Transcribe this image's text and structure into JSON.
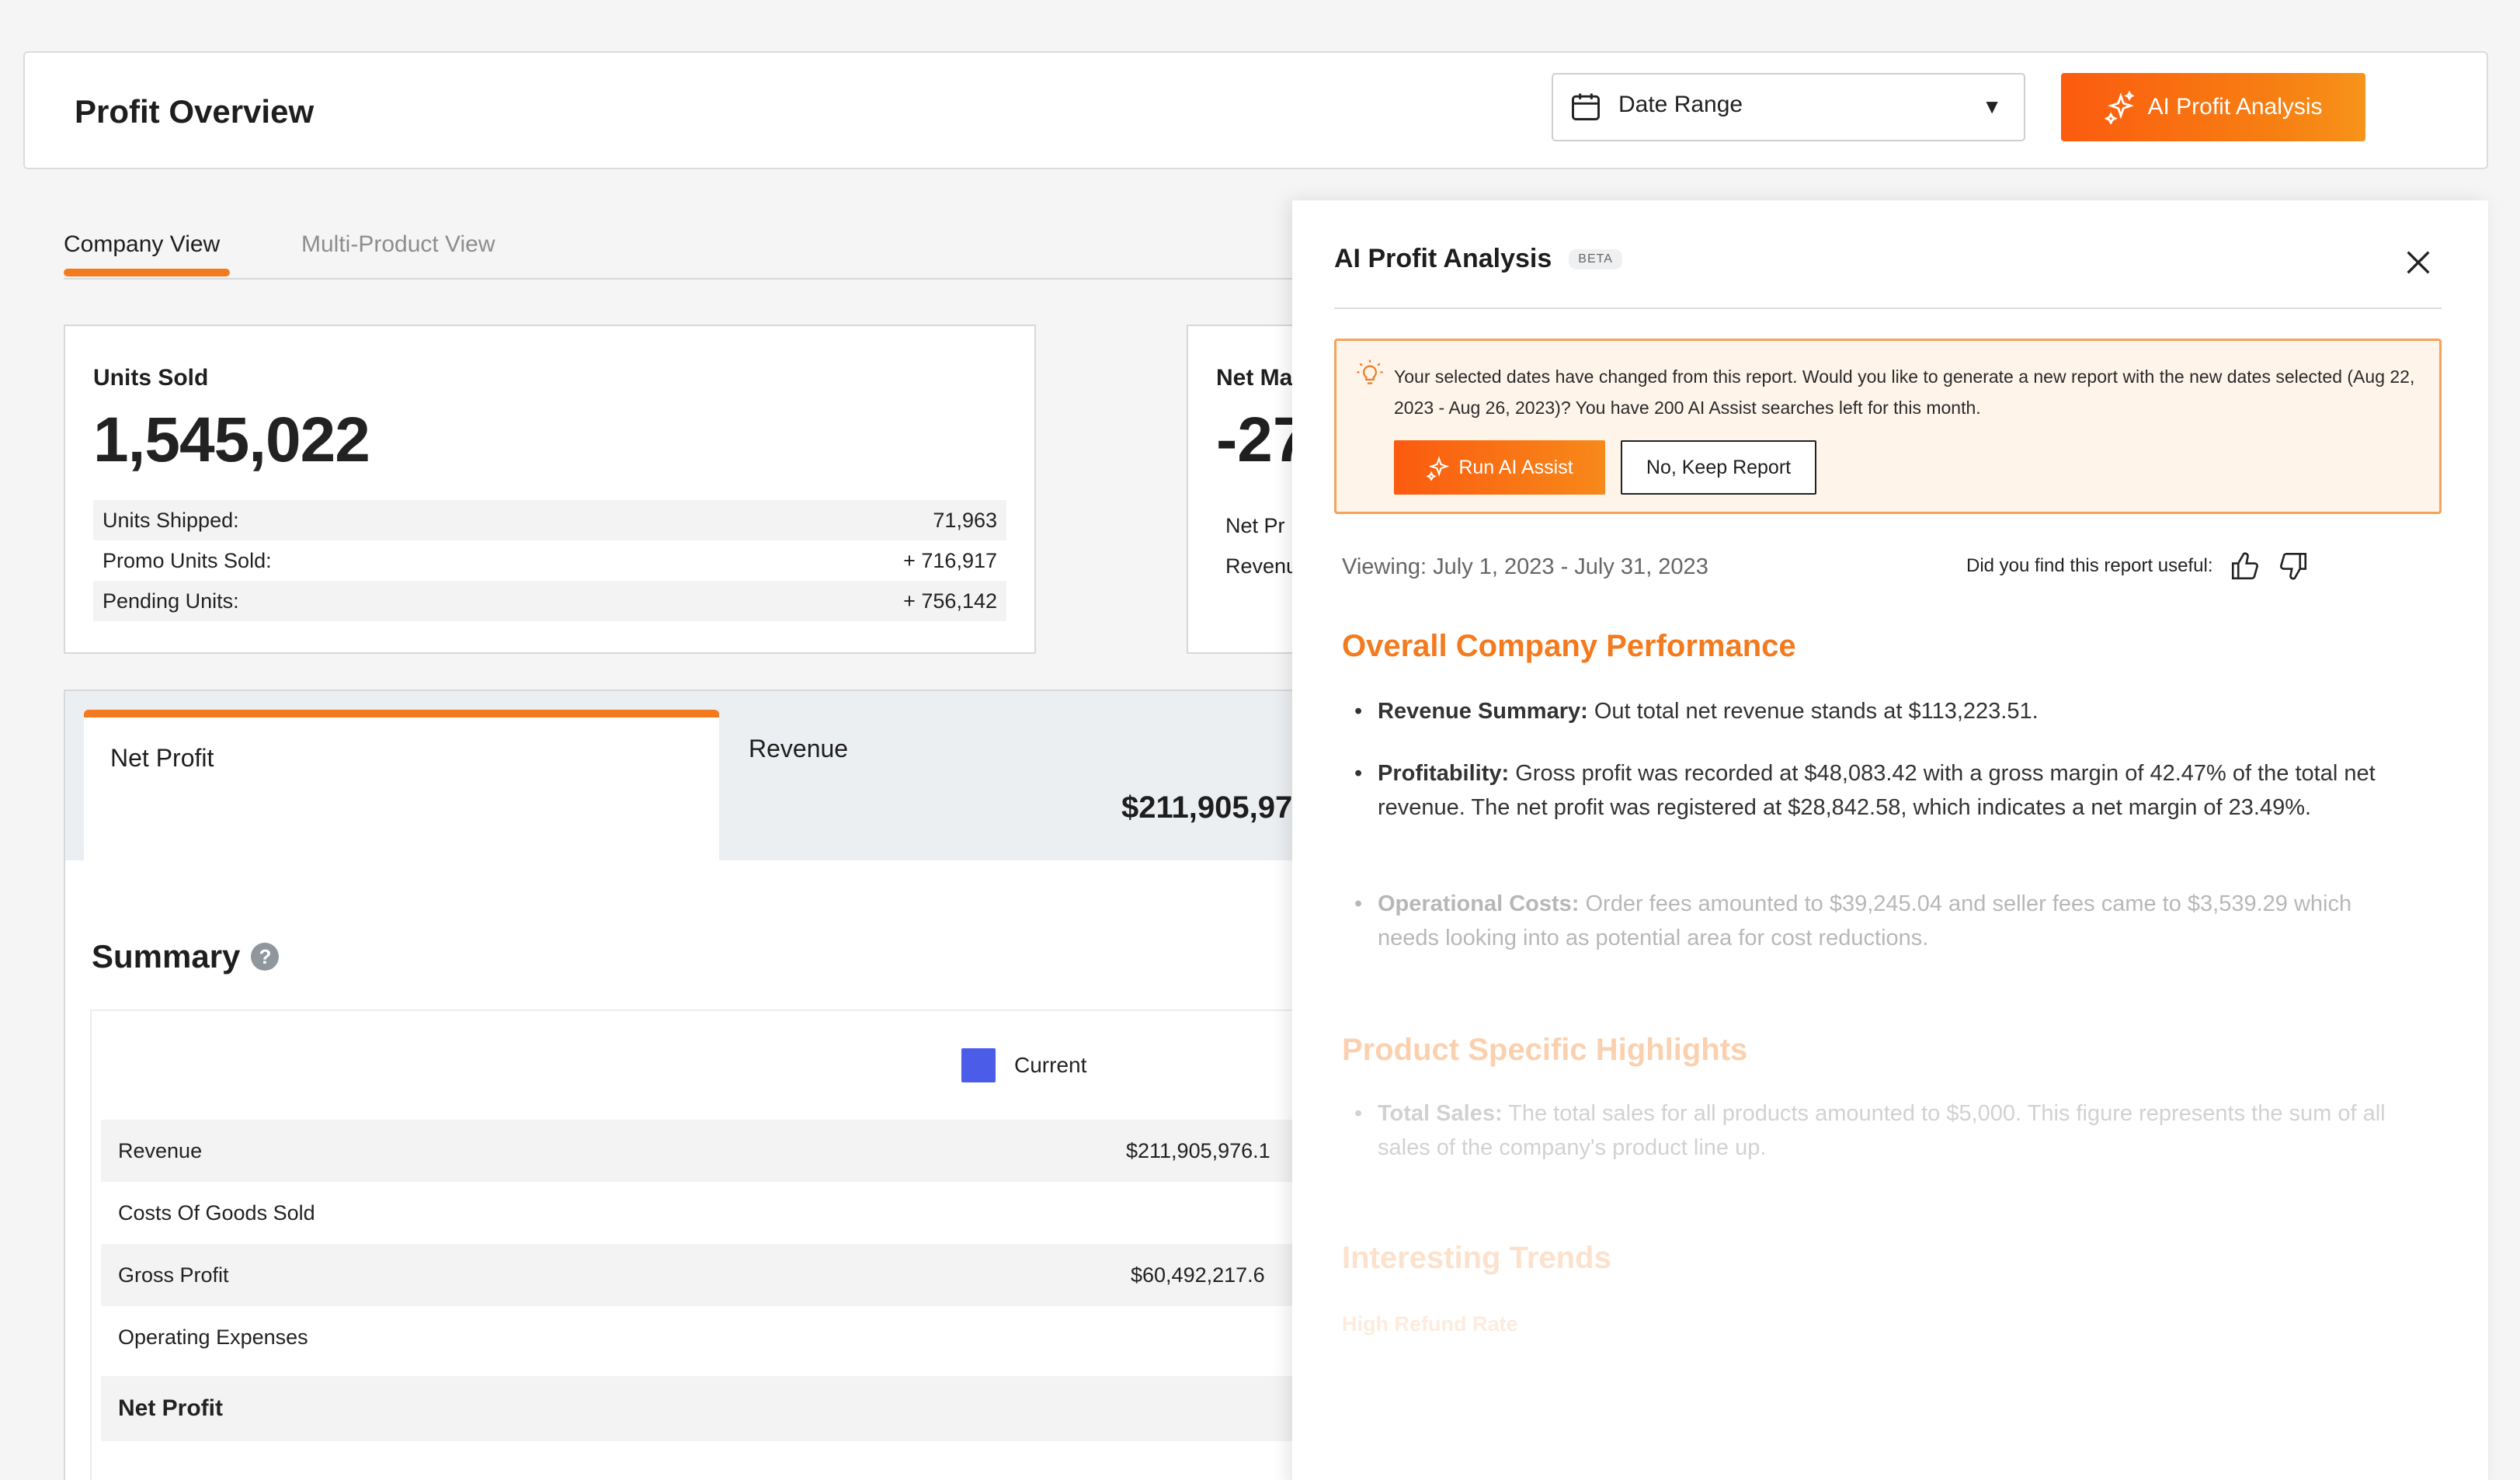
{
  "header": {
    "title": "Profit Overview",
    "date_range_label": "Date Range",
    "ai_button_label": "AI Profit Analysis"
  },
  "tabs": [
    {
      "label": "Company View",
      "active": true
    },
    {
      "label": "Multi-Product View",
      "active": false
    }
  ],
  "units_card": {
    "title": "Units Sold",
    "value": "1,545,022",
    "rows": [
      {
        "label": "Units Shipped:",
        "value": "71,963"
      },
      {
        "label": "Promo Units Sold:",
        "value": "+ 716,917"
      },
      {
        "label": "Pending Units:",
        "value": "+ 756,142"
      }
    ]
  },
  "margin_card": {
    "title": "Net Ma",
    "value": "-27",
    "row1": "Net Pr",
    "row2": "Revenu"
  },
  "profit_tabs": {
    "net_profit_label": "Net Profit",
    "revenue_label": "Revenue",
    "revenue_value": "$211,905,97"
  },
  "summary": {
    "title": "Summary",
    "help_glyph": "?",
    "legend_label": "Current",
    "legend_color": "#4a5ce8",
    "rows": [
      {
        "name": "Revenue",
        "value": "$211,905,976.1"
      },
      {
        "name": "Costs Of Goods Sold",
        "value": ""
      },
      {
        "name": "Gross Profit",
        "value": "$60,492,217.6"
      },
      {
        "name": "Operating Expenses",
        "value": ""
      },
      {
        "name": "Net Profit",
        "value": ""
      }
    ]
  },
  "ai_panel": {
    "title": "AI Profit Analysis",
    "badge": "BETA",
    "notice": "Your selected dates have changed from this report. Would you like to generate a new report with the new dates selected (Aug 22, 2023 - Aug 26, 2023)? You have 200 AI Assist searches left for this month.",
    "run_button": "Run AI Assist",
    "keep_button": "No, Keep Report",
    "viewing": "Viewing: July 1, 2023 - July 31, 2023",
    "feedback_question": "Did you find this report useful:",
    "sections": [
      {
        "heading": "Overall Company Performance",
        "bullets": [
          {
            "label": "Revenue Summary:",
            "text": " Out total net revenue stands at $113,223.51."
          },
          {
            "label": "Profitability:",
            "text": " Gross profit was recorded at $48,083.42 with a gross margin of 42.47% of the total net revenue. The net profit was registered at $28,842.58, which indicates a net margin of 23.49%."
          },
          {
            "label": "Operational Costs:",
            "text": " Order fees amounted to $39,245.04 and seller fees came to $3,539.29 which needs looking into as potential area for cost reductions."
          }
        ]
      },
      {
        "heading": "Product Specific Highlights",
        "bullets": [
          {
            "label": "Total Sales:",
            "text": " The total sales for all products amounted to $5,000. This figure represents the sum of all sales of the company's product line up."
          }
        ]
      },
      {
        "heading": "Interesting Trends",
        "subheading": "High Refund Rate"
      }
    ]
  },
  "colors": {
    "accent": "#f47a1e",
    "accent_gradient_start": "#fb5b0f",
    "notice_bg": "#fff4ea",
    "notice_border": "#f5a25a"
  }
}
